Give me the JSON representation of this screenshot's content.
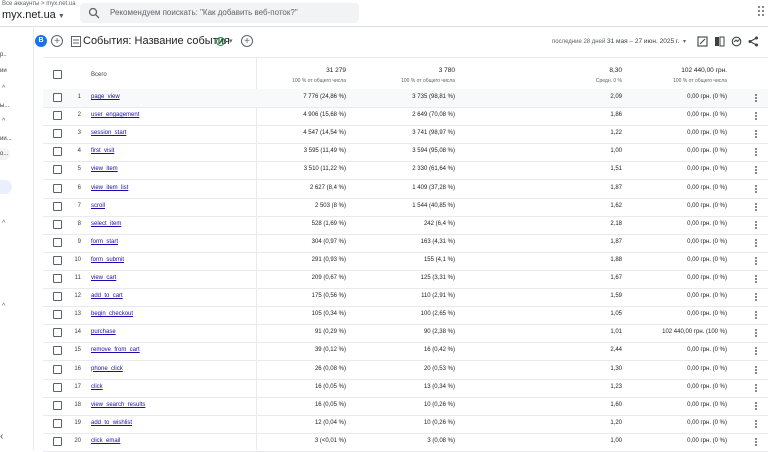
{
  "topbar": {
    "accounts_breadcrumb": "Все аккаунты > myx.net.ua",
    "account_name": "myx.net.ua",
    "search_placeholder": "Рекомендуем поискать: \"Как добавить веб-поток?\""
  },
  "sidebar": {
    "fragments": [
      "р..",
      "ии",
      "ы...",
      "ии...",
      "о..."
    ]
  },
  "subbar": {
    "badge": "B",
    "title": "События: Название события",
    "date_label": "последние 28 дней",
    "date_range": "31 мая – 27 июн. 2025 г."
  },
  "table": {
    "total_label": "Всего",
    "totals": [
      {
        "value": "31 279",
        "sub": "100 % от общего числа"
      },
      {
        "value": "3 780",
        "sub": "100 % от общего числа"
      },
      {
        "value": "8,30",
        "sub": "Средн. 0 %"
      },
      {
        "value": "102 440,00 грн.",
        "sub": "100 % от общего числа"
      }
    ],
    "rows": [
      {
        "num": "1",
        "name": "page_view",
        "c1": "7 776 (24,86 %)",
        "c2": "3 735 (98,81 %)",
        "c3": "2,09",
        "c4": "0,00 грн. (0 %)"
      },
      {
        "num": "2",
        "name": "user_engagement",
        "c1": "4 906 (15,68 %)",
        "c2": "2 649 (70,08 %)",
        "c3": "1,86",
        "c4": "0,00 грн. (0 %)"
      },
      {
        "num": "3",
        "name": "session_start",
        "c1": "4 547 (14,54 %)",
        "c2": "3 741 (98,97 %)",
        "c3": "1,22",
        "c4": "0,00 грн. (0 %)"
      },
      {
        "num": "4",
        "name": "first_visit",
        "c1": "3 595 (11,49 %)",
        "c2": "3 594 (95,08 %)",
        "c3": "1,00",
        "c4": "0,00 грн. (0 %)"
      },
      {
        "num": "5",
        "name": "view_item",
        "c1": "3 510 (11,22 %)",
        "c2": "2 330 (61,64 %)",
        "c3": "1,51",
        "c4": "0,00 грн. (0 %)"
      },
      {
        "num": "6",
        "name": "view_item_list",
        "c1": "2 627 (8,4 %)",
        "c2": "1 409 (37,28 %)",
        "c3": "1,87",
        "c4": "0,00 грн. (0 %)"
      },
      {
        "num": "7",
        "name": "scroll",
        "c1": "2 503 (8 %)",
        "c2": "1 544 (40,85 %)",
        "c3": "1,62",
        "c4": "0,00 грн. (0 %)"
      },
      {
        "num": "8",
        "name": "select_item",
        "c1": "528 (1,69 %)",
        "c2": "242 (6,4 %)",
        "c3": "2,18",
        "c4": "0,00 грн. (0 %)"
      },
      {
        "num": "9",
        "name": "form_start",
        "c1": "304 (0,97 %)",
        "c2": "163 (4,31 %)",
        "c3": "1,87",
        "c4": "0,00 грн. (0 %)"
      },
      {
        "num": "10",
        "name": "form_submit",
        "c1": "291 (0,93 %)",
        "c2": "155 (4,1 %)",
        "c3": "1,88",
        "c4": "0,00 грн. (0 %)"
      },
      {
        "num": "11",
        "name": "view_cart",
        "c1": "209 (0,67 %)",
        "c2": "125 (3,31 %)",
        "c3": "1,67",
        "c4": "0,00 грн. (0 %)"
      },
      {
        "num": "12",
        "name": "add_to_cart",
        "c1": "175 (0,56 %)",
        "c2": "110 (2,91 %)",
        "c3": "1,59",
        "c4": "0,00 грн. (0 %)"
      },
      {
        "num": "13",
        "name": "begin_checkout",
        "c1": "105 (0,34 %)",
        "c2": "100 (2,65 %)",
        "c3": "1,05",
        "c4": "0,00 грн. (0 %)"
      },
      {
        "num": "14",
        "name": "purchase",
        "c1": "91 (0,29 %)",
        "c2": "90 (2,38 %)",
        "c3": "1,01",
        "c4": "102 440,00 грн. (100 %)"
      },
      {
        "num": "15",
        "name": "remove_from_cart",
        "c1": "39 (0,12 %)",
        "c2": "16 (0,42 %)",
        "c3": "2,44",
        "c4": "0,00 грн. (0 %)"
      },
      {
        "num": "16",
        "name": "phone_click",
        "c1": "26 (0,08 %)",
        "c2": "20 (0,53 %)",
        "c3": "1,30",
        "c4": "0,00 грн. (0 %)"
      },
      {
        "num": "17",
        "name": "click",
        "c1": "16 (0,05 %)",
        "c2": "13 (0,34 %)",
        "c3": "1,23",
        "c4": "0,00 грн. (0 %)"
      },
      {
        "num": "18",
        "name": "view_search_results",
        "c1": "16 (0,05 %)",
        "c2": "10 (0,26 %)",
        "c3": "1,60",
        "c4": "0,00 грн. (0 %)"
      },
      {
        "num": "19",
        "name": "add_to_wishlist",
        "c1": "12 (0,04 %)",
        "c2": "10 (0,26 %)",
        "c3": "1,20",
        "c4": "0,00 грн. (0 %)"
      },
      {
        "num": "20",
        "name": "click_email",
        "c1": "3 (<0,01 %)",
        "c2": "3 (0,08 %)",
        "c3": "1,00",
        "c4": "0,00 грн. (0 %)"
      }
    ]
  }
}
